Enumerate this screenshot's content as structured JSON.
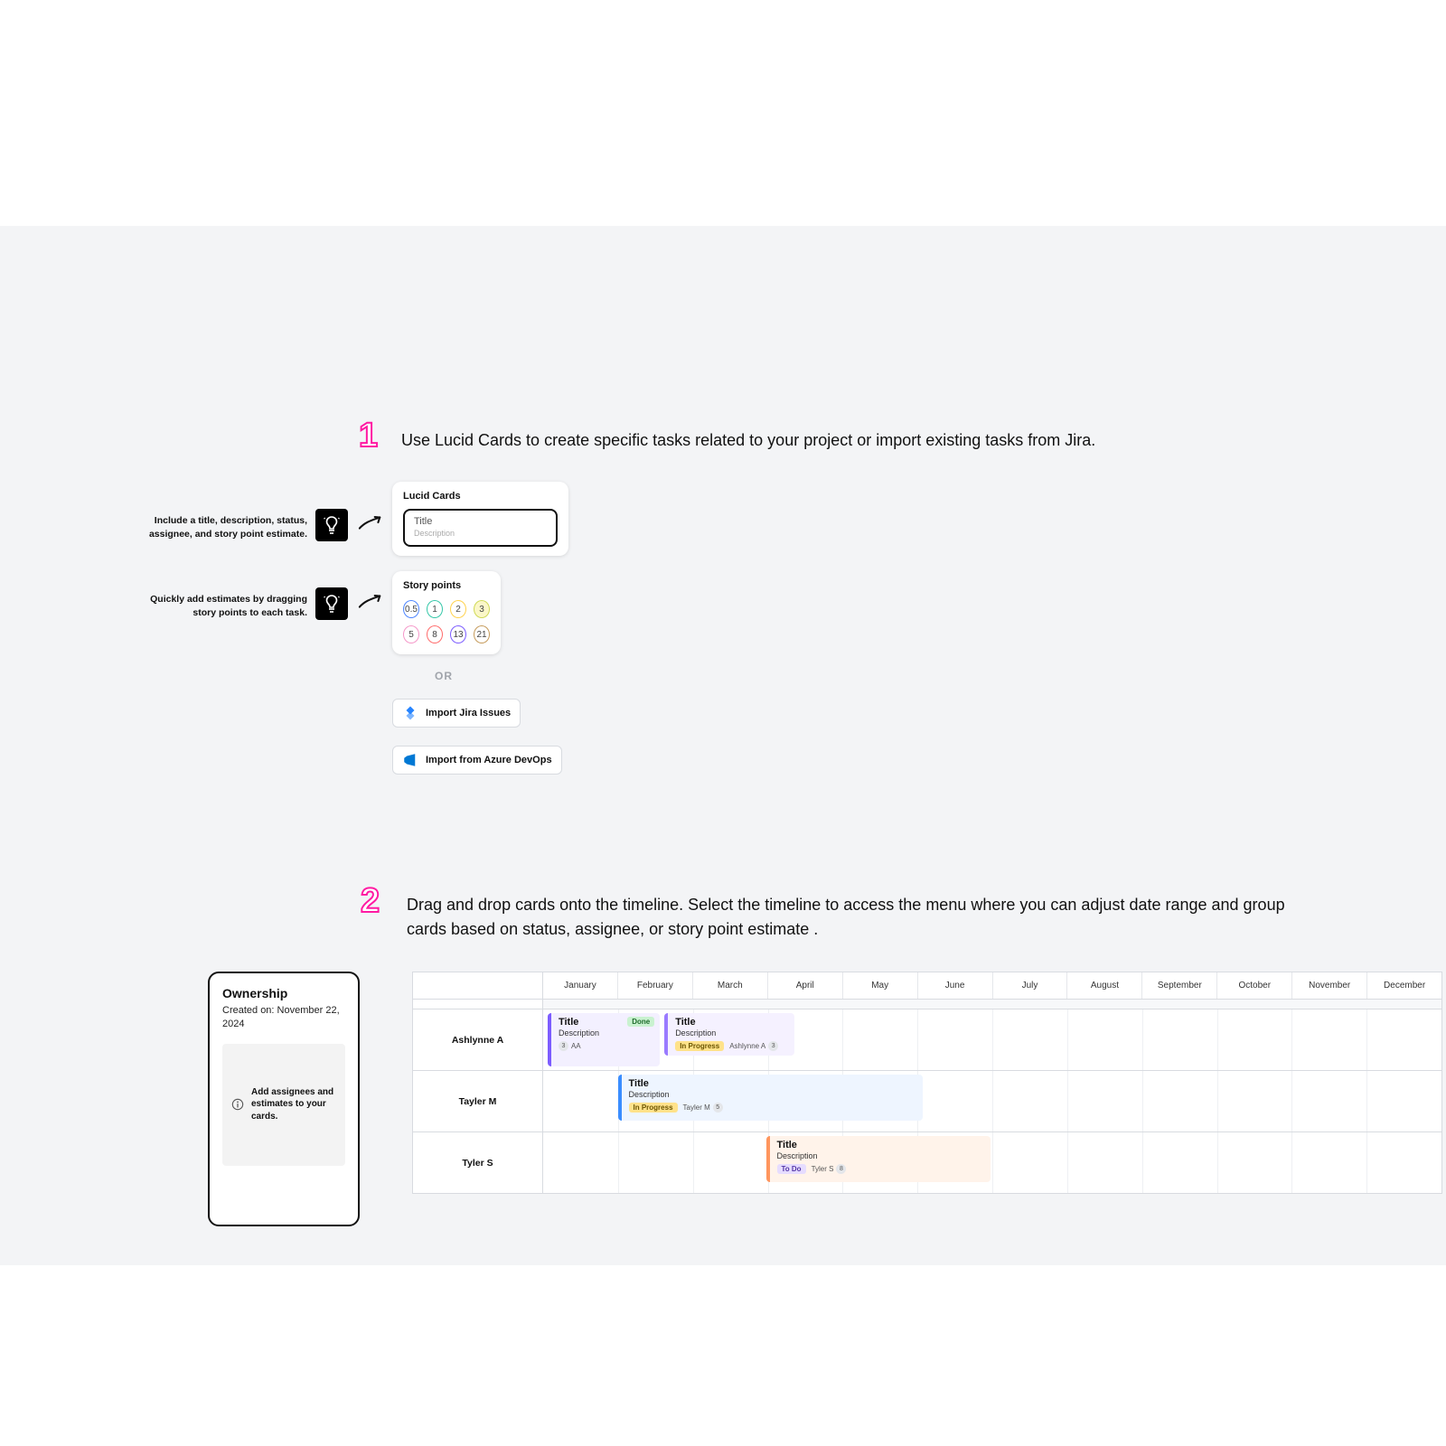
{
  "steps": {
    "s1_num": "1",
    "s1_text": "Use Lucid Cards to create specific tasks related to your project or import existing tasks from Jira.",
    "s2_num": "2",
    "s2_text": "Drag and drop cards onto the timeline. Select the timeline to access the menu where you can adjust date range and group cards based on status, assignee, or story point estimate ."
  },
  "tips": {
    "t1": "Include a title, description, status, assignee, and story point estimate.",
    "t2": "Quickly add estimates by dragging story points to each task."
  },
  "lucid_card": {
    "title": "Lucid Cards",
    "line1": "Title",
    "line2": "Description"
  },
  "story_points": {
    "title": "Story points",
    "values": [
      "0.5",
      "1",
      "2",
      "3",
      "5",
      "8",
      "13",
      "21"
    ]
  },
  "sep": "OR",
  "import": {
    "jira": "Import Jira Issues",
    "azure": "Import from Azure DevOps"
  },
  "ownership": {
    "title": "Ownership",
    "created": "Created on: November 22, 2024",
    "inner": "Add assignees and estimates to your cards."
  },
  "timeline": {
    "months": [
      "January",
      "February",
      "March",
      "April",
      "May",
      "June",
      "July",
      "August",
      "September",
      "October",
      "November",
      "December"
    ],
    "rows": {
      "r1": {
        "assignee": "Ashlynne A",
        "card1": {
          "title": "Title",
          "desc": "Description",
          "status": "Done",
          "who": "AA",
          "pt": "3"
        },
        "card2": {
          "title": "Title",
          "desc": "Description",
          "status": "In Progress",
          "who": "Ashlynne A",
          "pt": "3"
        }
      },
      "r2": {
        "assignee": "Tayler M",
        "card": {
          "title": "Title",
          "desc": "Description",
          "status": "In Progress",
          "who": "Tayler M",
          "pt": "5"
        }
      },
      "r3": {
        "assignee": "Tyler S",
        "card": {
          "title": "Title",
          "desc": "Description",
          "status": "To Do",
          "who": "Tyler S",
          "pt": "8"
        }
      }
    }
  }
}
